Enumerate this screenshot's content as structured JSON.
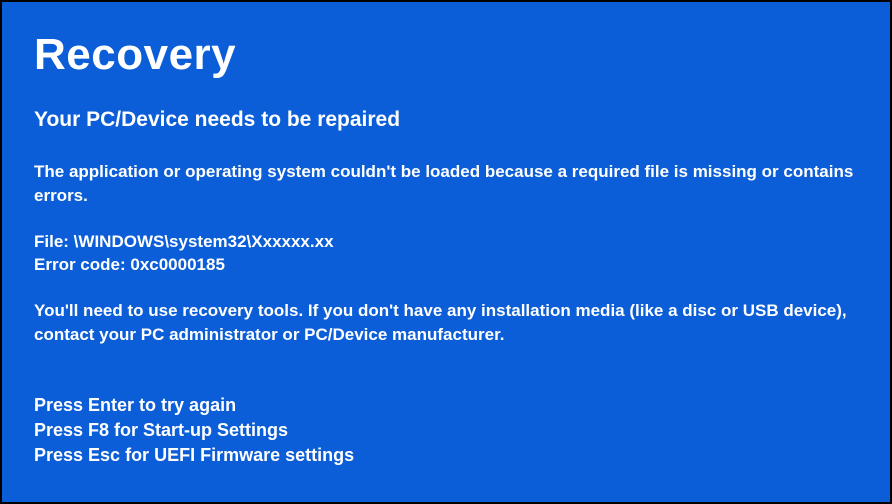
{
  "title": "Recovery",
  "subtitle": "Your PC/Device needs to be repaired",
  "description": "The application or operating system couldn't be loaded because a required file is missing or contains errors.",
  "file": {
    "label": "File: ",
    "path": "\\WINDOWS\\system32\\Xxxxxx.xx"
  },
  "error": {
    "label": "Error code: ",
    "code": "0xc0000185"
  },
  "recovery_note": "You'll need to use recovery tools. If you don't have any installation media (like a disc or USB device), contact your PC administrator or PC/Device manufacturer.",
  "keypress": {
    "enter": "Press Enter to try again",
    "f8": "Press F8 for Start-up Settings",
    "esc": "Press Esc for UEFI Firmware settings"
  }
}
